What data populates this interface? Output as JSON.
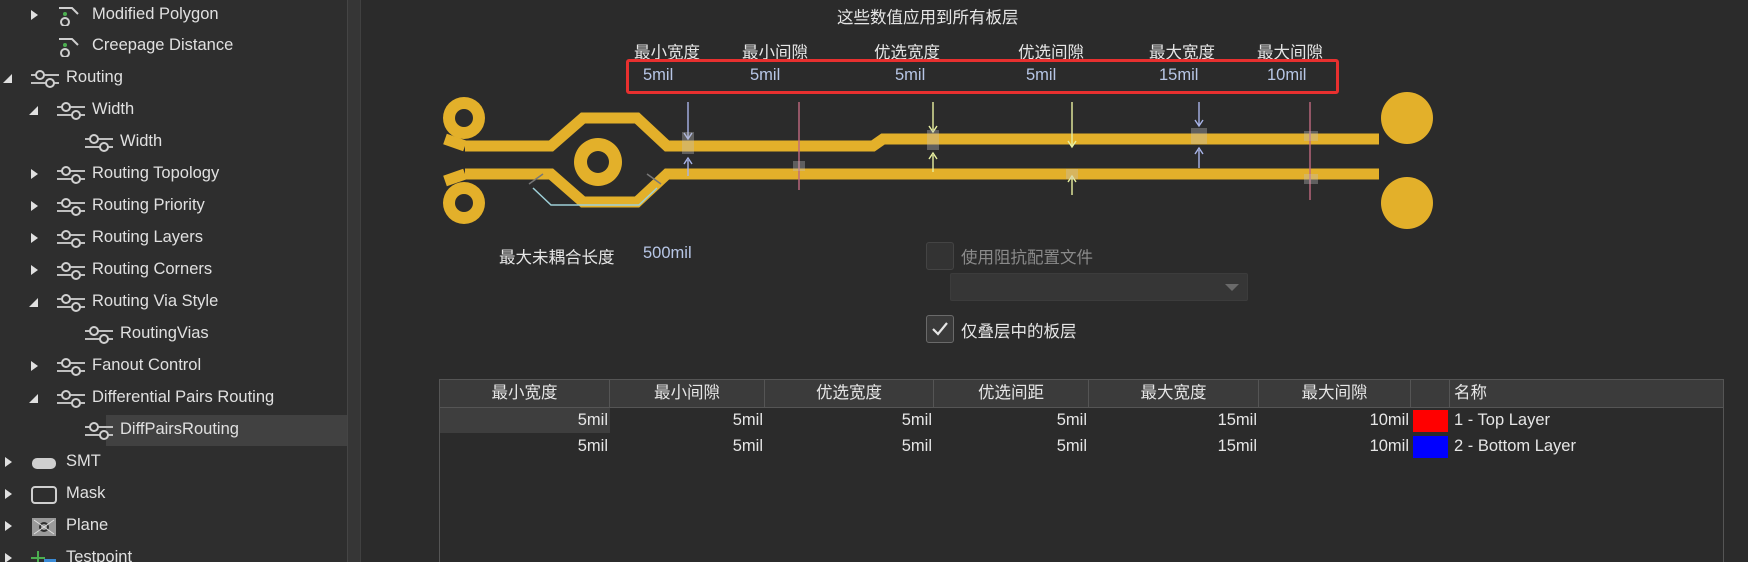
{
  "tree": {
    "items": [
      {
        "label": "Modified Polygon",
        "icon": "polygon-rule-icon",
        "arrow": "collapsed"
      },
      {
        "label": "Creepage Distance",
        "icon": "polygon-rule-icon",
        "arrow": "none"
      },
      {
        "label": "Routing",
        "icon": "routing-rule-icon",
        "arrow": "expanded"
      },
      {
        "label": "Width",
        "icon": "routing-rule-icon",
        "arrow": "expanded"
      },
      {
        "label": "Width",
        "icon": "routing-rule-icon",
        "arrow": "none"
      },
      {
        "label": "Routing Topology",
        "icon": "routing-rule-icon",
        "arrow": "collapsed"
      },
      {
        "label": "Routing Priority",
        "icon": "routing-rule-icon",
        "arrow": "collapsed"
      },
      {
        "label": "Routing Layers",
        "icon": "routing-rule-icon",
        "arrow": "collapsed"
      },
      {
        "label": "Routing Corners",
        "icon": "routing-rule-icon",
        "arrow": "collapsed"
      },
      {
        "label": "Routing Via Style",
        "icon": "routing-rule-icon",
        "arrow": "expanded"
      },
      {
        "label": "RoutingVias",
        "icon": "routing-rule-icon",
        "arrow": "none"
      },
      {
        "label": "Fanout Control",
        "icon": "routing-rule-icon",
        "arrow": "collapsed"
      },
      {
        "label": "Differential Pairs Routing",
        "icon": "routing-rule-icon",
        "arrow": "expanded"
      },
      {
        "label": "DiffPairsRouting",
        "icon": "routing-rule-icon",
        "arrow": "none",
        "selected": true
      },
      {
        "label": "SMT",
        "icon": "smt-icon",
        "arrow": "collapsed"
      },
      {
        "label": "Mask",
        "icon": "mask-icon",
        "arrow": "collapsed"
      },
      {
        "label": "Plane",
        "icon": "plane-icon",
        "arrow": "collapsed"
      },
      {
        "label": "Testpoint",
        "icon": "testpoint-icon",
        "arrow": "collapsed"
      }
    ]
  },
  "main": {
    "heading": "这些数值应用到所有板层",
    "params": [
      {
        "label": "最小宽度",
        "value": "5mil"
      },
      {
        "label": "最小间隙",
        "value": "5mil"
      },
      {
        "label": "优选宽度",
        "value": "5mil"
      },
      {
        "label": "优选间隙",
        "value": "5mil"
      },
      {
        "label": "最大宽度",
        "value": "15mil"
      },
      {
        "label": "最大间隙",
        "value": "10mil"
      }
    ],
    "uncoupled_label": "最大未耦合长度",
    "uncoupled_value": "500mil",
    "impedance_label": "使用阻抗配置文件",
    "impedance_combo": "",
    "stack_only_label": "仅叠层中的板层",
    "stack_only_checked": true
  },
  "table": {
    "headers": [
      "最小宽度",
      "最小间隙",
      "优选宽度",
      "优选间距",
      "最大宽度",
      "最大间隙",
      "",
      "名称"
    ],
    "rows": [
      {
        "cells": [
          "5mil",
          "5mil",
          "5mil",
          "5mil",
          "15mil",
          "10mil"
        ],
        "color": "#ff0000",
        "name": "1 - Top Layer"
      },
      {
        "cells": [
          "5mil",
          "5mil",
          "5mil",
          "5mil",
          "15mil",
          "10mil"
        ],
        "color": "#0000ff",
        "name": "2 - Bottom Layer"
      }
    ]
  },
  "colors": {
    "track": "#e3b02a",
    "highlight_box": "#e8302f",
    "gap_arrow": "#b0a8e8",
    "pref_arrow": "#e8f0a0",
    "max_arrow": "#a8b4e8"
  }
}
